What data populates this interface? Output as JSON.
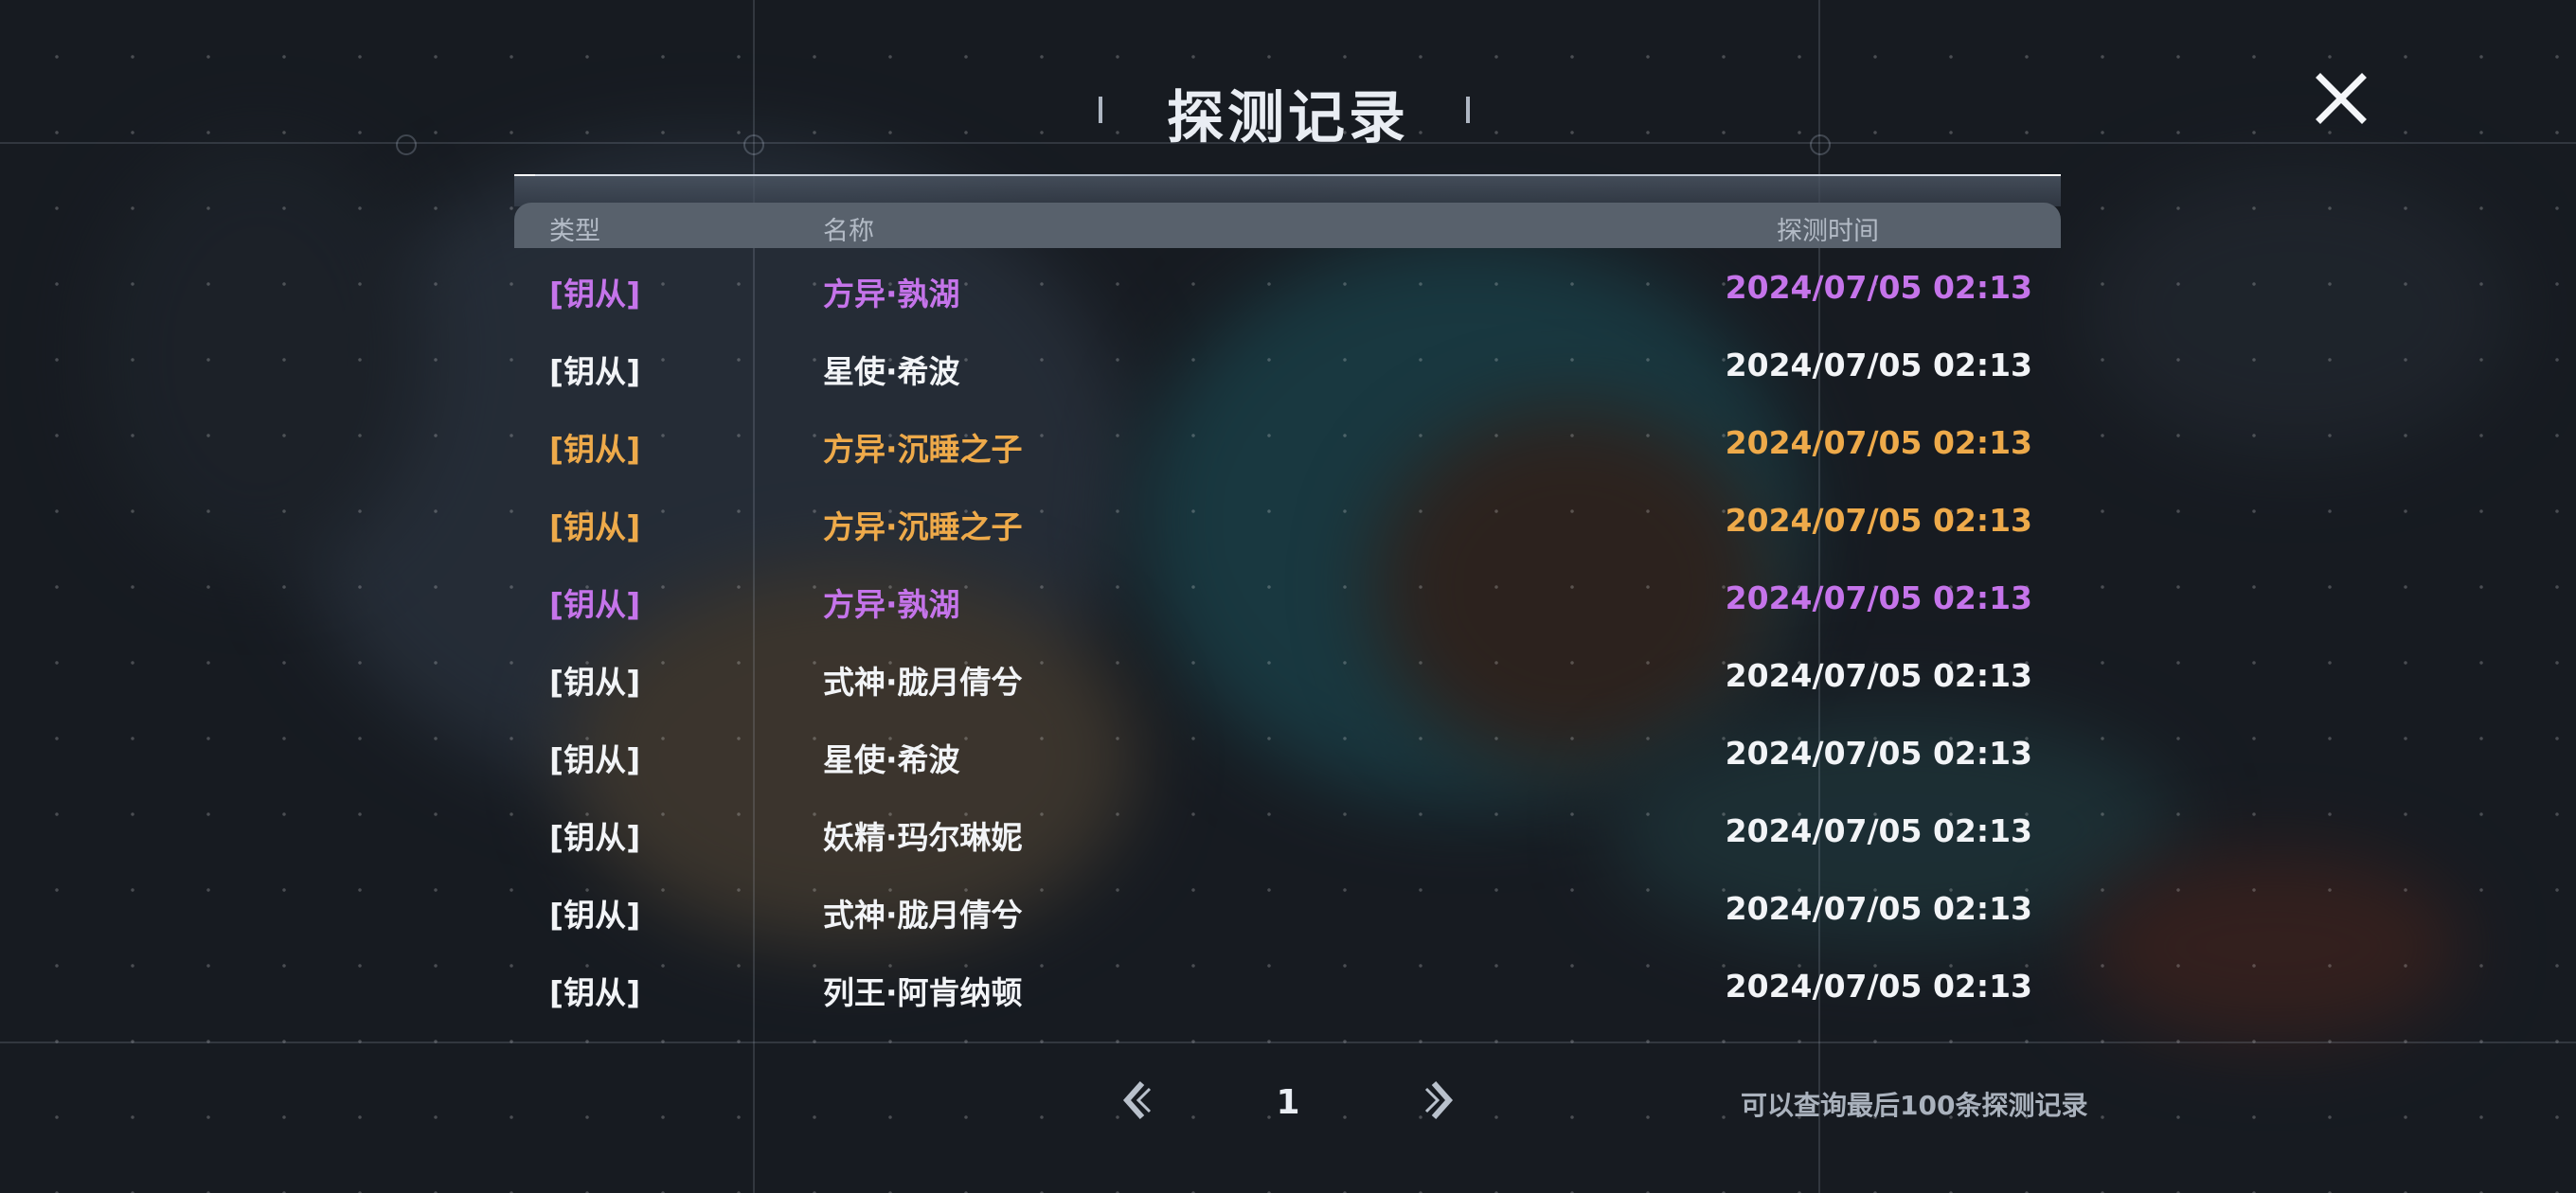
{
  "title": "探测记录",
  "colors": {
    "purple": "#c574ea",
    "white": "#f2f4f7",
    "orange": "#eeaa4a"
  },
  "table": {
    "headers": {
      "type": "类型",
      "name": "名称",
      "time": "探测时间"
    },
    "rows": [
      {
        "type": "[钥从]",
        "name": "方异·孰湖",
        "time": "2024/07/05 02:13",
        "rarity": "purple"
      },
      {
        "type": "[钥从]",
        "name": "星使·希波",
        "time": "2024/07/05 02:13",
        "rarity": "white"
      },
      {
        "type": "[钥从]",
        "name": "方异·沉睡之子",
        "time": "2024/07/05 02:13",
        "rarity": "orange"
      },
      {
        "type": "[钥从]",
        "name": "方异·沉睡之子",
        "time": "2024/07/05 02:13",
        "rarity": "orange"
      },
      {
        "type": "[钥从]",
        "name": "方异·孰湖",
        "time": "2024/07/05 02:13",
        "rarity": "purple"
      },
      {
        "type": "[钥从]",
        "name": "式神·胧月倩兮",
        "time": "2024/07/05 02:13",
        "rarity": "white"
      },
      {
        "type": "[钥从]",
        "name": "星使·希波",
        "time": "2024/07/05 02:13",
        "rarity": "white"
      },
      {
        "type": "[钥从]",
        "name": "妖精·玛尔琳妮",
        "time": "2024/07/05 02:13",
        "rarity": "white"
      },
      {
        "type": "[钥从]",
        "name": "式神·胧月倩兮",
        "time": "2024/07/05 02:13",
        "rarity": "white"
      },
      {
        "type": "[钥从]",
        "name": "列王·阿肯纳顿",
        "time": "2024/07/05 02:13",
        "rarity": "white"
      }
    ]
  },
  "pagination": {
    "current_page": "1",
    "prev_icon": "chevron-left-icon",
    "next_icon": "chevron-right-icon"
  },
  "hint": "可以查询最后100条探测记录",
  "close_icon": "close-icon"
}
